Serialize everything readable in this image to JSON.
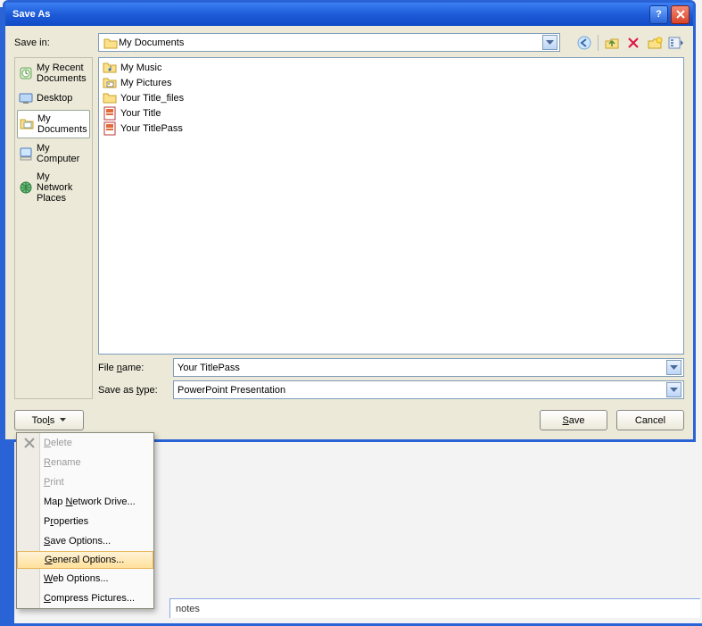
{
  "dialog": {
    "title": "Save As",
    "save_in_label": "Save in:",
    "save_in_value": "My Documents",
    "filename_label": "File name:",
    "filename_value": "Your TitlePass",
    "type_label": "Save as type:",
    "type_value": "PowerPoint Presentation",
    "save_btn": "Save",
    "cancel_btn": "Cancel",
    "tools_btn": "Tools"
  },
  "places": [
    {
      "label": "My Recent Documents",
      "icon": "recent"
    },
    {
      "label": "Desktop",
      "icon": "desktop"
    },
    {
      "label": "My Documents",
      "icon": "documents",
      "selected": true
    },
    {
      "label": "My Computer",
      "icon": "computer"
    },
    {
      "label": "My Network Places",
      "icon": "network"
    }
  ],
  "files": [
    {
      "name": "My Music",
      "icon": "folder-music"
    },
    {
      "name": "My Pictures",
      "icon": "folder-pictures"
    },
    {
      "name": "Your Title_files",
      "icon": "folder"
    },
    {
      "name": "Your Title",
      "icon": "ppt"
    },
    {
      "name": "Your TitlePass",
      "icon": "ppt"
    }
  ],
  "tools_menu": [
    {
      "label": "Delete",
      "u": 0,
      "disabled": true,
      "icon": "delete"
    },
    {
      "label": "Rename",
      "u": 0,
      "disabled": true
    },
    {
      "label": "Print",
      "u": 0,
      "disabled": true
    },
    {
      "label": "Map Network Drive...",
      "u": 4
    },
    {
      "label": "Properties",
      "u": 1
    },
    {
      "label": "Save Options...",
      "u": 0
    },
    {
      "label": "General Options...",
      "u": 0,
      "hot": true
    },
    {
      "label": "Web Options...",
      "u": 0
    },
    {
      "label": "Compress Pictures...",
      "u": 0
    }
  ],
  "notes": "notes"
}
